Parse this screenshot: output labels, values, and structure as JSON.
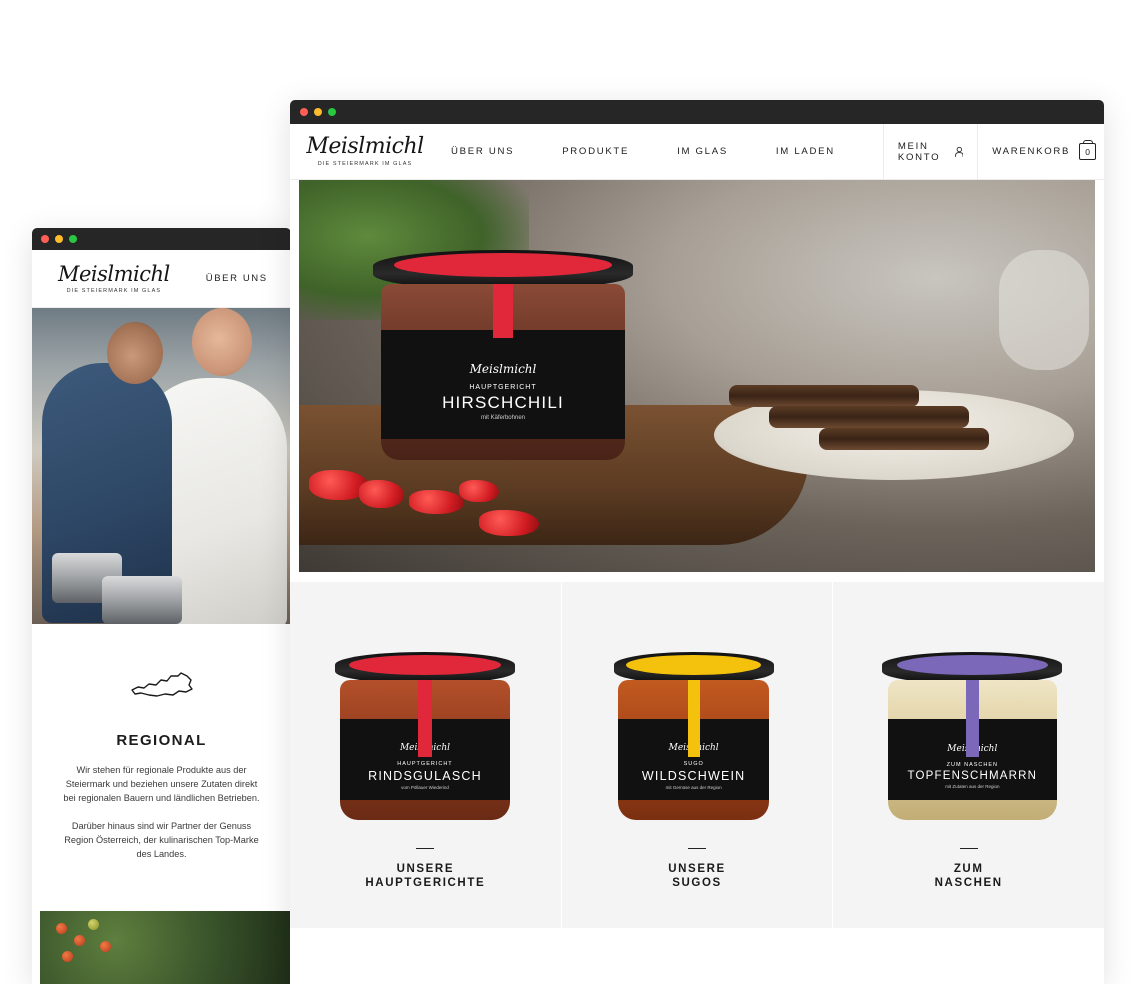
{
  "brand": {
    "name": "Meislmichl",
    "tagline": "DIE STEIERMARK IM GLAS"
  },
  "colors": {
    "chrome_bar": "#262626",
    "dot_red": "#ff5f57",
    "dot_yellow": "#febc2e",
    "dot_green": "#28c840",
    "band_red": "#e0283a",
    "band_yellow": "#f4c20d",
    "band_purple": "#7b68b8"
  },
  "mobile": {
    "nav": {
      "link": "ÜBER UNS"
    },
    "section": {
      "icon": "austria-map-icon",
      "title": "REGIONAL",
      "paragraph1": "Wir stehen für regionale Produkte aus der Steiermark und beziehen unsere Zutaten direkt bei regionalen Bauern und ländlichen Betrieben.",
      "paragraph2": "Darüber hinaus sind wir Partner der Genuss Region Österreich, der kulinarischen Top-Marke des Landes."
    }
  },
  "desktop": {
    "menu": [
      "ÜBER UNS",
      "PRODUKTE",
      "IM GLAS",
      "IM LADEN"
    ],
    "account_label": "MEIN KONTO",
    "account_icon": "user-icon",
    "cart_label": "WARENKORB",
    "cart_count": "0",
    "cart_icon": "basket-icon",
    "hero_jar": {
      "brand": "Meislmichl",
      "category": "HAUPTGERICHT",
      "name": "HIRSCHCHILI",
      "sub": "mit Käferbohnen"
    },
    "products": [
      {
        "jar_brand": "Meislmichl",
        "category": "HAUPTGERICHT",
        "name": "RINDSGULASCH",
        "sub": "vom Pöllauer Wiederind",
        "title_line1": "UNSERE",
        "title_line2": "HAUPTGERICHTE"
      },
      {
        "jar_brand": "Meislmichl",
        "category": "SUGO",
        "name": "WILDSCHWEIN",
        "sub": "mit Gemüse aus der Region",
        "title_line1": "UNSERE",
        "title_line2": "SUGOS"
      },
      {
        "jar_brand": "Meislmichl",
        "category": "ZUM NASCHEN",
        "name": "TOPFENSCHMARRN",
        "sub": "mit Zutaten aus der Region",
        "title_line1": "ZUM",
        "title_line2": "NASCHEN"
      }
    ]
  }
}
